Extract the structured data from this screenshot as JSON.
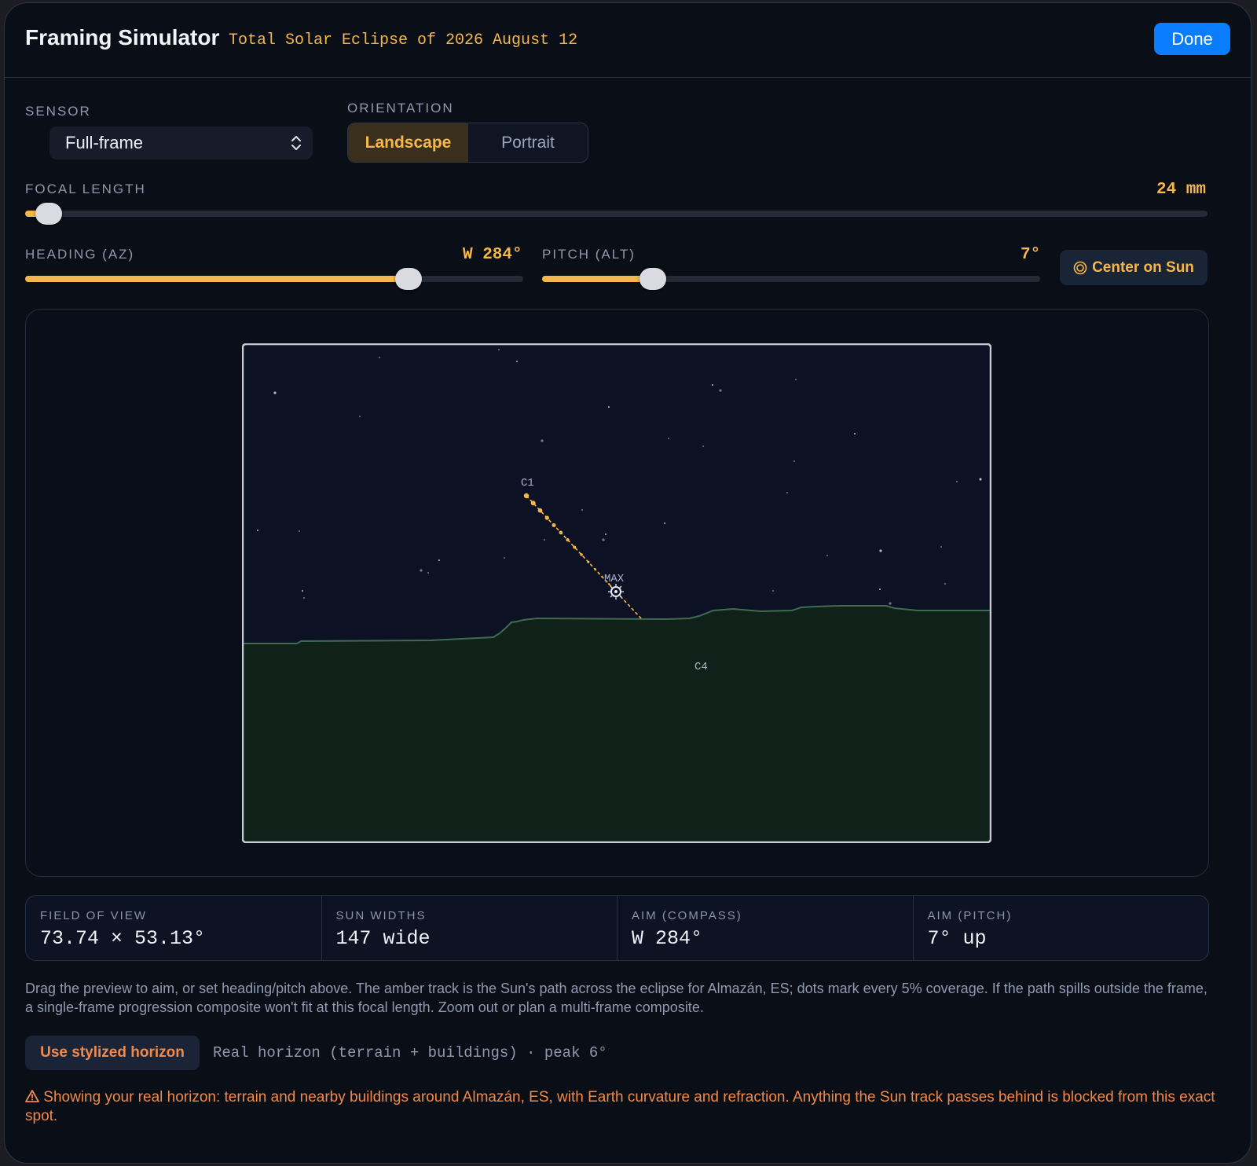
{
  "header": {
    "title": "Framing Simulator",
    "subtitle": "Total Solar Eclipse of 2026 August 12",
    "done_label": "Done"
  },
  "sensor": {
    "label": "SENSOR",
    "value": "Full-frame"
  },
  "orientation": {
    "label": "ORIENTATION",
    "options": [
      "Landscape",
      "Portrait"
    ],
    "selected": "Landscape"
  },
  "focal_length": {
    "label": "FOCAL LENGTH",
    "value_text": "24 mm",
    "level": 0.02
  },
  "heading": {
    "label": "HEADING (AZ)",
    "value_text": "W 284°",
    "level": 0.77
  },
  "pitch": {
    "label": "PITCH (ALT)",
    "value_text": "7°",
    "level": 0.223
  },
  "center_button": {
    "icon": "target-icon",
    "label": "Center on Sun"
  },
  "preview": {
    "markers": {
      "start": "C1",
      "max": "MAX",
      "end": "C4"
    },
    "colors": {
      "sky": "#0c1224",
      "ground": "#0f2118",
      "horizon_line": "#3f6b52",
      "track": "#f5b74a"
    }
  },
  "stats": [
    {
      "key": "FIELD OF VIEW",
      "value": "73.74 × 53.13°"
    },
    {
      "key": "SUN WIDTHS",
      "value": "147 wide"
    },
    {
      "key": "AIM (COMPASS)",
      "value": "W 284°"
    },
    {
      "key": "AIM (PITCH)",
      "value": "7° up"
    }
  ],
  "help_text": "Drag the preview to aim, or set heading/pitch above. The amber track is the Sun's path across the eclipse for Almazán, ES; dots mark every 5% coverage. If the path spills outside the frame, a single-frame progression composite won't fit at this focal length. Zoom out or plan a multi-frame composite.",
  "horizon": {
    "button_label": "Use stylized horizon",
    "info": "Real horizon (terrain + buildings) · peak 6°"
  },
  "warning": {
    "icon": "warning-icon",
    "text": "Showing your real horizon: terrain and nearby buildings around Almazán, ES, with Earth curvature and refraction. Anything the Sun track passes behind is blocked from this exact spot."
  }
}
